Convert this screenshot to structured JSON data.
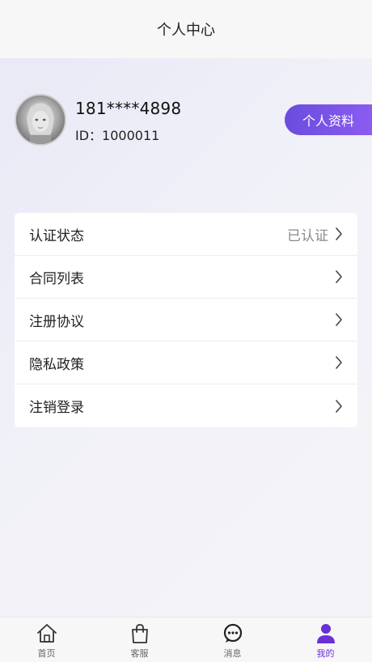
{
  "header": {
    "title": "个人中心"
  },
  "profile": {
    "phone": "181****4898",
    "id_text": "ID：1000011",
    "button_label": "个人资料"
  },
  "menu": {
    "items": [
      {
        "label": "认证状态",
        "value": "已认证"
      },
      {
        "label": "合同列表",
        "value": ""
      },
      {
        "label": "注册协议",
        "value": ""
      },
      {
        "label": "隐私政策",
        "value": ""
      },
      {
        "label": "注销登录",
        "value": ""
      }
    ]
  },
  "tabbar": {
    "tabs": [
      {
        "label": "首页",
        "icon": "home-icon"
      },
      {
        "label": "客服",
        "icon": "shopping-bag-icon"
      },
      {
        "label": "消息",
        "icon": "chat-bubble-icon"
      },
      {
        "label": "我的",
        "icon": "user-icon"
      }
    ],
    "active_index": 3,
    "active_color": "#6a2fd8"
  },
  "colors": {
    "accent_start": "#6a4cdf",
    "accent_end": "#8a5cf0"
  }
}
